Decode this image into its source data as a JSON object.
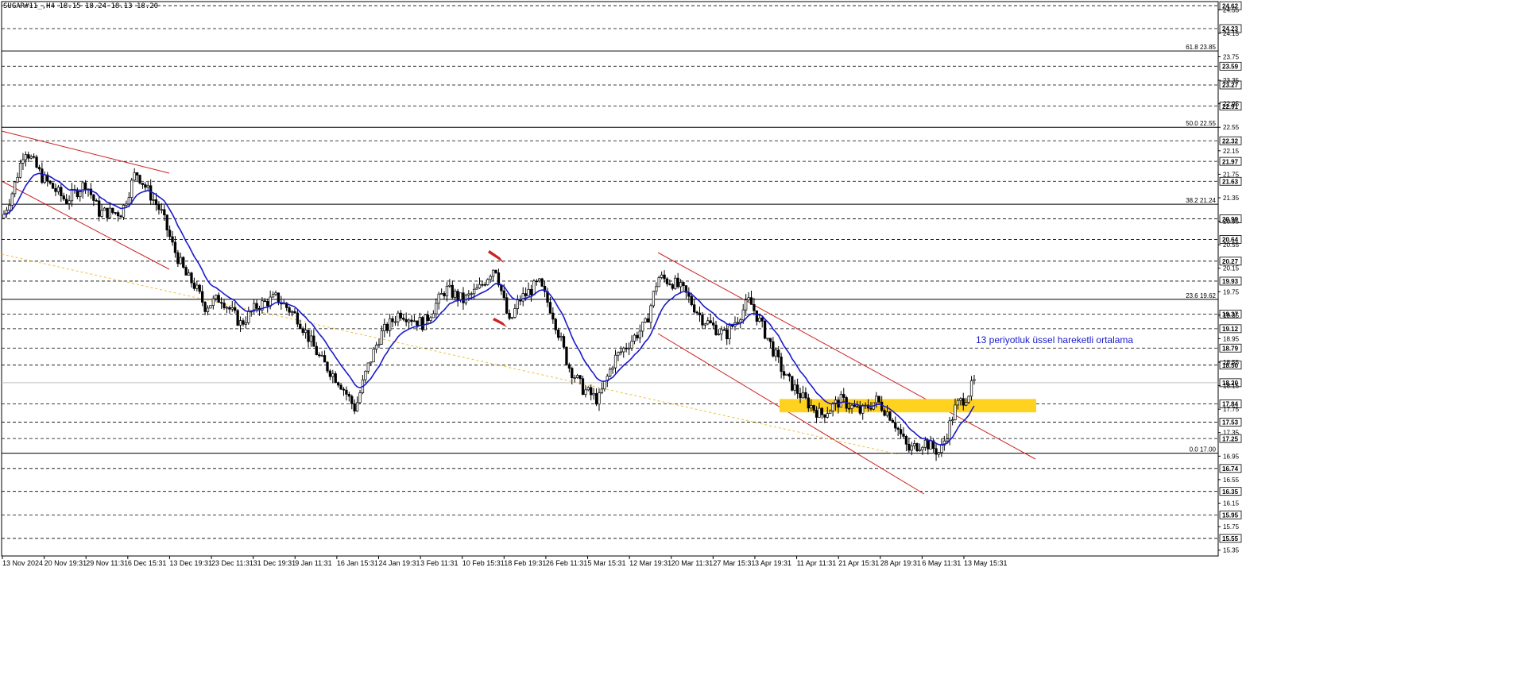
{
  "chart_data": {
    "type": "candlestick",
    "symbol_label": "SUGAR#11_,H4  18.15 18.24 18.13 18.20",
    "timeframe": "H4",
    "ohlc_last": {
      "open": 18.15,
      "high": 18.24,
      "low": 18.13,
      "close": 18.2
    },
    "ylim": [
      15.25,
      24.69
    ],
    "y_ticks": [
      24.55,
      24.15,
      23.75,
      23.35,
      22.95,
      22.55,
      22.15,
      21.75,
      21.35,
      20.95,
      20.55,
      20.15,
      19.75,
      19.35,
      18.95,
      18.55,
      18.15,
      17.75,
      17.35,
      16.95,
      16.55,
      16.15,
      15.75,
      15.35
    ],
    "x_tick_labels": [
      "13 Nov 2024",
      "20 Nov 19:31",
      "29 Nov 11:31",
      "6 Dec 15:31",
      "13 Dec 19:31",
      "23 Dec 11:31",
      "31 Dec 19:31",
      "9 Jan 11:31",
      "16 Jan 15:31",
      "24 Jan 19:31",
      "3 Feb 11:31",
      "10 Feb 15:31",
      "18 Feb 19:31",
      "26 Feb 11:31",
      "5 Mar 15:31",
      "12 Mar 19:31",
      "20 Mar 11:31",
      "27 Mar 15:31",
      "3 Apr 19:31",
      "11 Apr 11:31",
      "21 Apr 15:31",
      "28 Apr 19:31",
      "6 May 11:31",
      "13 May 15:31"
    ],
    "horizontal_levels": [
      "24.62",
      "24.23",
      "23.59",
      "23.27",
      "22.91",
      "22.32",
      "21.97",
      "21.63",
      "20.99",
      "20.64",
      "20.27",
      "19.93",
      "19.37",
      "19.12",
      "18.79",
      "18.50",
      "17.84",
      "17.53",
      "17.25",
      "16.74",
      "16.35",
      "15.95",
      "15.55"
    ],
    "current_price": "18.20",
    "fibonacci": [
      {
        "label": "61.8 23.85",
        "value": 23.85
      },
      {
        "label": "50.0 22.55",
        "value": 22.55
      },
      {
        "label": "38.2 21.24",
        "value": 21.24
      },
      {
        "label": "23.6 19.62",
        "value": 19.62
      },
      {
        "label": "0.0 17.00",
        "value": 17.0
      }
    ],
    "zone": {
      "low": 17.75,
      "high": 17.95,
      "color": "#FFD21F"
    },
    "ema_period": 13,
    "annotation": "13 periyotluk üssel hareketli ortalama",
    "series_key_points": [
      [
        0,
        21.0
      ],
      [
        14,
        21.5
      ],
      [
        28,
        22.2
      ],
      [
        50,
        21.7
      ],
      [
        80,
        21.3
      ],
      [
        105,
        21.6
      ],
      [
        122,
        21.1
      ],
      [
        150,
        21.1
      ],
      [
        168,
        21.8
      ],
      [
        200,
        21.1
      ],
      [
        215,
        20.5
      ],
      [
        232,
        20.0
      ],
      [
        240,
        19.9
      ],
      [
        255,
        19.5
      ],
      [
        275,
        19.65
      ],
      [
        300,
        19.2
      ],
      [
        320,
        19.5
      ],
      [
        345,
        19.65
      ],
      [
        372,
        19.3
      ],
      [
        400,
        18.6
      ],
      [
        425,
        18.2
      ],
      [
        444,
        17.75
      ],
      [
        458,
        18.4
      ],
      [
        475,
        19.0
      ],
      [
        500,
        19.4
      ],
      [
        530,
        19.2
      ],
      [
        558,
        19.8
      ],
      [
        580,
        19.6
      ],
      [
        600,
        19.8
      ],
      [
        620,
        20.2
      ],
      [
        638,
        19.2
      ],
      [
        650,
        19.6
      ],
      [
        675,
        19.9
      ],
      [
        692,
        19.4
      ],
      [
        712,
        18.5
      ],
      [
        730,
        18.1
      ],
      [
        750,
        17.9
      ],
      [
        770,
        18.6
      ],
      [
        790,
        18.9
      ],
      [
        810,
        19.2
      ],
      [
        825,
        20.0
      ],
      [
        845,
        19.9
      ],
      [
        858,
        19.75
      ],
      [
        880,
        19.3
      ],
      [
        910,
        19.0
      ],
      [
        940,
        19.6
      ],
      [
        965,
        18.9
      ],
      [
        985,
        18.3
      ],
      [
        1010,
        17.9
      ],
      [
        1030,
        17.65
      ],
      [
        1055,
        17.9
      ],
      [
        1080,
        17.7
      ],
      [
        1100,
        17.9
      ],
      [
        1120,
        17.6
      ],
      [
        1140,
        17.05
      ],
      [
        1160,
        17.2
      ],
      [
        1180,
        17.0
      ],
      [
        1200,
        17.8
      ],
      [
        1215,
        18.0
      ],
      [
        1222,
        18.2
      ]
    ]
  }
}
